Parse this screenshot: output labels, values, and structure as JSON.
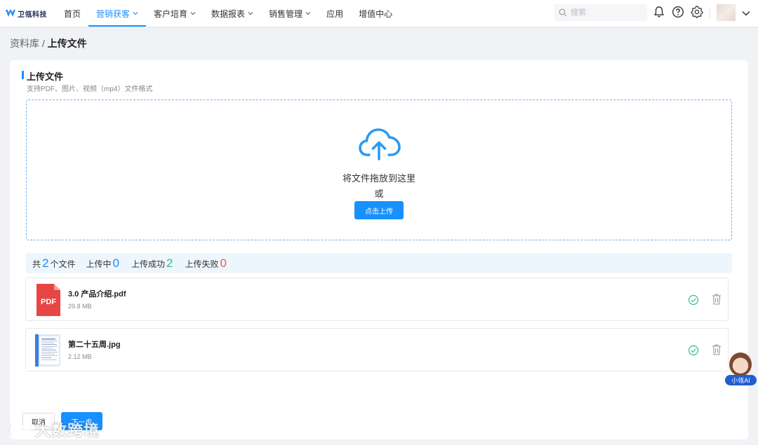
{
  "brand": {
    "name": "卫瓴科技"
  },
  "nav": {
    "items": [
      {
        "label": "首页",
        "active": false,
        "has_dropdown": false
      },
      {
        "label": "营销获客",
        "active": true,
        "has_dropdown": true
      },
      {
        "label": "客户培育",
        "active": false,
        "has_dropdown": true
      },
      {
        "label": "数据报表",
        "active": false,
        "has_dropdown": true
      },
      {
        "label": "销售管理",
        "active": false,
        "has_dropdown": true
      },
      {
        "label": "应用",
        "active": false,
        "has_dropdown": false
      },
      {
        "label": "增值中心",
        "active": false,
        "has_dropdown": false
      }
    ],
    "search_placeholder": "搜索",
    "icons": [
      "bell-icon",
      "help-icon",
      "gear-icon",
      "avatar",
      "chevron-down-icon"
    ]
  },
  "breadcrumb": {
    "parent": "资料库",
    "separator": " / ",
    "current": "上传文件"
  },
  "upload": {
    "title": "上传文件",
    "subtitle": "支持PDF、图片、视频（mp4）文件格式",
    "drop_text": "将文件拖放到这里",
    "or_text": "或",
    "button_label": "点击上传"
  },
  "stats": {
    "total_prefix": "共",
    "total": "2",
    "total_suffix": "个文件",
    "uploading_label": "上传中",
    "uploading": "0",
    "success_label": "上传成功",
    "success": "2",
    "failed_label": "上传失败",
    "failed": "0"
  },
  "files": [
    {
      "name": "3.0 产品介绍.pdf",
      "size": "29.8 MB",
      "type": "pdf",
      "icon_label": "PDF",
      "status": "success"
    },
    {
      "name": "第二十五周.jpg",
      "size": "2.12 MB",
      "type": "image",
      "status": "success"
    }
  ],
  "actions": {
    "cancel_label": "取消",
    "next_label": "下一步"
  },
  "assistant": {
    "label": "小瓴AI"
  },
  "watermark": {
    "text": "大数跨境"
  },
  "colors": {
    "accent": "#1890ff",
    "success": "#2fbf85",
    "danger": "#f05454",
    "pdf_red": "#e84545"
  }
}
